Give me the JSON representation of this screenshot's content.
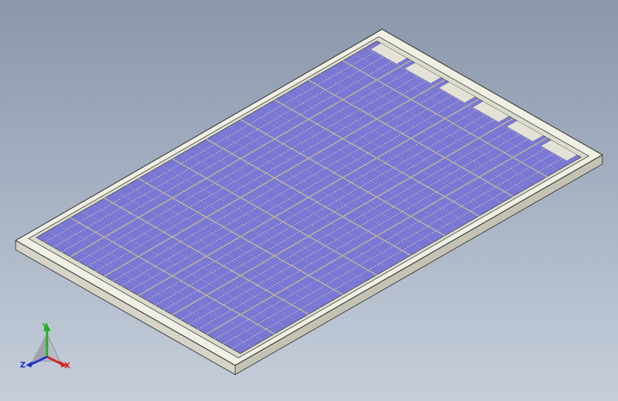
{
  "viewport": {
    "background_top": "#8a97aa",
    "background_bottom": "#c6ceda"
  },
  "model": {
    "name": "solar-panel",
    "frame_color": "#f0efe4",
    "frame_edge_color": "#3a3a3a",
    "cell_color": "#7a78d4",
    "busbar_color": "#d8d3b8",
    "cell_columns": 6,
    "cell_rows": 10
  },
  "triad": {
    "x_label": "X",
    "y_label": "Y",
    "z_label": "Z",
    "x_color": "#d42020",
    "y_color": "#20b020",
    "z_color": "#2030d0"
  }
}
